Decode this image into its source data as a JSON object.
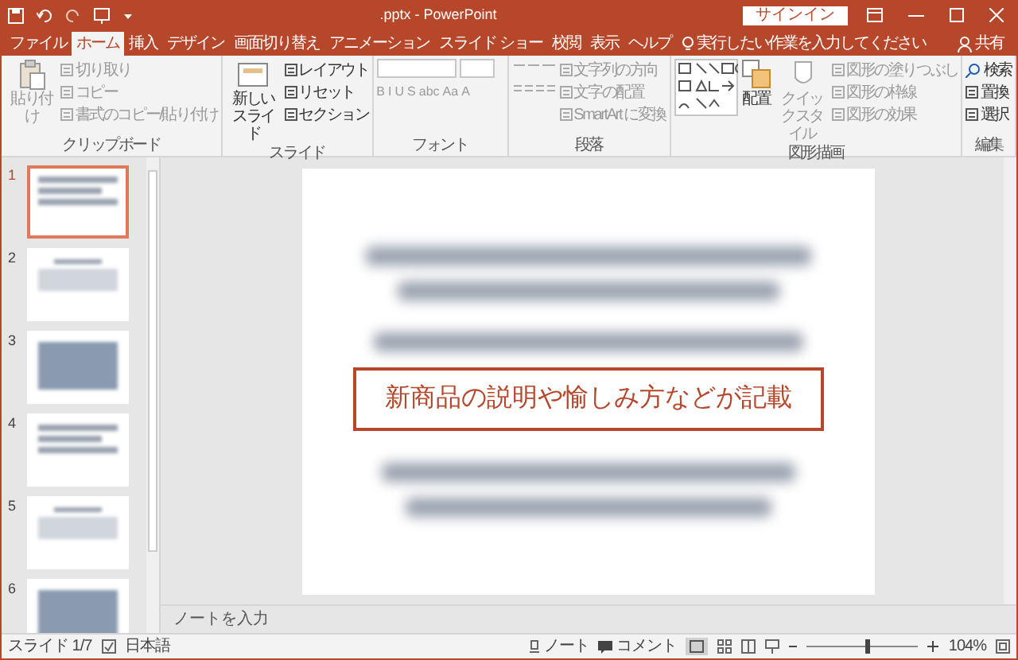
{
  "title_bar": {
    "title": ".pptx - PowerPoint",
    "sign_in": "サインイン"
  },
  "tabs": [
    {
      "label": "ファイル",
      "selected": false
    },
    {
      "label": "ホーム",
      "selected": true
    },
    {
      "label": "挿入",
      "selected": false
    },
    {
      "label": "デザイン",
      "selected": false
    },
    {
      "label": "画面切り替え",
      "selected": false
    },
    {
      "label": "アニメーション",
      "selected": false
    },
    {
      "label": "スライド ショー",
      "selected": false
    },
    {
      "label": "校閲",
      "selected": false
    },
    {
      "label": "表示",
      "selected": false
    },
    {
      "label": "ヘルプ",
      "selected": false
    }
  ],
  "tell_me": "実行したい作業を入力してください",
  "share": "共有",
  "ribbon": [
    {
      "label": "クリップボード",
      "items": [
        {
          "kind": "large",
          "label": "貼り付け",
          "disabled": true
        },
        {
          "kind": "small",
          "label": "切り取り",
          "disabled": true
        },
        {
          "kind": "small",
          "label": "コピー",
          "disabled": true
        },
        {
          "kind": "small",
          "label": "書式のコピー/貼り付け",
          "disabled": true
        }
      ]
    },
    {
      "label": "スライド",
      "items": [
        {
          "kind": "large",
          "label": "新しいスライド",
          "disabled": false
        },
        {
          "kind": "small",
          "label": "レイアウト",
          "disabled": false
        },
        {
          "kind": "small",
          "label": "リセット",
          "disabled": false
        },
        {
          "kind": "small",
          "label": "セクション",
          "disabled": false
        }
      ]
    },
    {
      "label": "フォント",
      "items": [
        {
          "kind": "font",
          "format_buttons": [
            "B",
            "I",
            "U",
            "S",
            "abc",
            "Aa",
            "A"
          ]
        }
      ]
    },
    {
      "label": "段落",
      "items": [
        {
          "kind": "paragraph"
        },
        {
          "kind": "small",
          "label": "文字列の方向",
          "disabled": true
        },
        {
          "kind": "small",
          "label": "文字の配置",
          "disabled": true
        },
        {
          "kind": "small",
          "label": "SmartArt に変換",
          "disabled": true
        }
      ]
    },
    {
      "label": "図形描画",
      "items": [
        {
          "kind": "gallery"
        },
        {
          "kind": "large",
          "label": "配置",
          "disabled": false
        },
        {
          "kind": "large",
          "label": "クイックスタイル",
          "disabled": true
        },
        {
          "kind": "small",
          "label": "図形の塗りつぶし",
          "disabled": true
        },
        {
          "kind": "small",
          "label": "図形の枠線",
          "disabled": true
        },
        {
          "kind": "small",
          "label": "図形の効果",
          "disabled": true
        }
      ]
    },
    {
      "label": "編集",
      "items": [
        {
          "kind": "small",
          "label": "検索",
          "disabled": false
        },
        {
          "kind": "small",
          "label": "置換",
          "disabled": false
        },
        {
          "kind": "small",
          "label": "選択",
          "disabled": false
        }
      ]
    }
  ],
  "thumbnails": [
    {
      "number": "1",
      "selected": true
    },
    {
      "number": "2",
      "selected": false
    },
    {
      "number": "3",
      "selected": false
    },
    {
      "number": "4",
      "selected": false
    },
    {
      "number": "5",
      "selected": false
    },
    {
      "number": "6",
      "selected": false
    }
  ],
  "slide": {
    "callout": "新商品の説明や愉しみ方などが記載"
  },
  "notes_placeholder": "ノートを入力",
  "status_bar": {
    "slide": "スライド 1/7",
    "language": "日本語",
    "notes": "ノート",
    "comments": "コメント",
    "zoom": {
      "level": 0.55,
      "reading": "104%"
    }
  }
}
